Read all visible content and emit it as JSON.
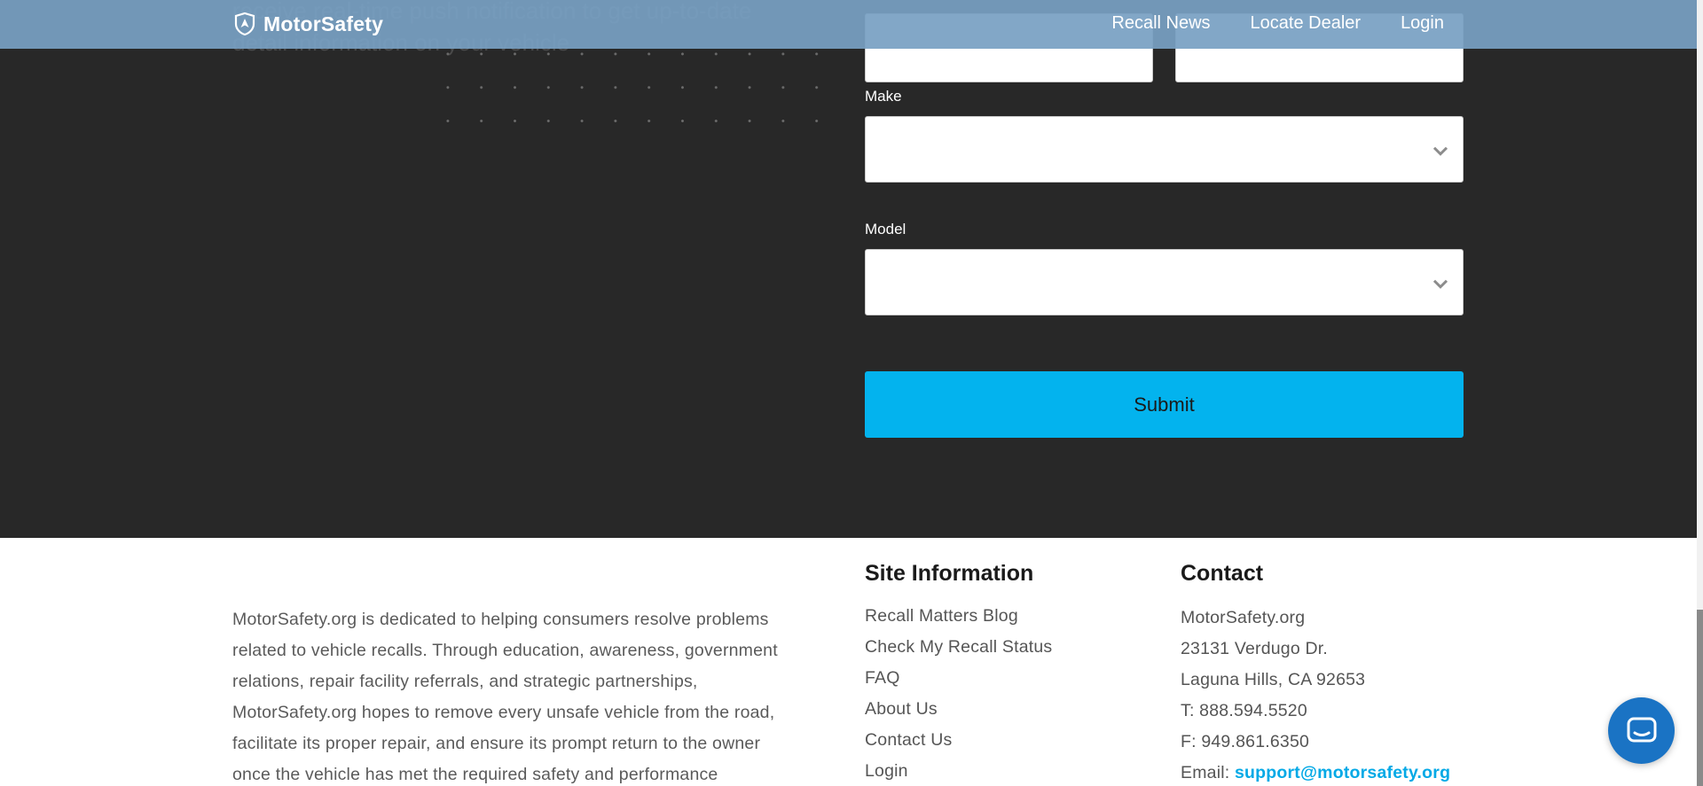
{
  "header": {
    "brand": "MotorSafety",
    "nav": {
      "recall_news": "Recall News",
      "locate_dealer": "Locate Dealer",
      "login": "Login"
    }
  },
  "hero": {
    "background_text": "receive real-time push notification to get up-to-date detail information on your vehicle"
  },
  "form": {
    "make_label": "Make",
    "make_value": "",
    "model_label": "Model",
    "model_value": "",
    "submit_label": "Submit"
  },
  "footer": {
    "about_text": "MotorSafety.org is dedicated to helping consumers resolve problems related to vehicle recalls. Through education, awareness, government relations, repair facility referrals, and strategic partnerships, MotorSafety.org hopes to remove every unsafe vehicle from the road, facilitate its proper repair, and ensure its prompt return to the owner once the vehicle has met the required safety and performance",
    "site_info": {
      "heading": "Site Information",
      "links": [
        "Recall Matters Blog",
        "Check My Recall Status",
        "FAQ",
        "About Us",
        "Contact Us",
        "Login"
      ]
    },
    "contact": {
      "heading": "Contact",
      "org": "MotorSafety.org",
      "street": "23131 Verdugo Dr.",
      "city": "Laguna Hills, CA 92653",
      "phone": "T: 888.594.5520",
      "fax": "F: 949.861.6350",
      "email_label": "Email: ",
      "email": "support@motorsafety.org"
    }
  },
  "colors": {
    "dark_bg": "#282828",
    "header_bg": "#78a0c3",
    "accent": "#03b3ee",
    "chat": "#1a73c4"
  }
}
